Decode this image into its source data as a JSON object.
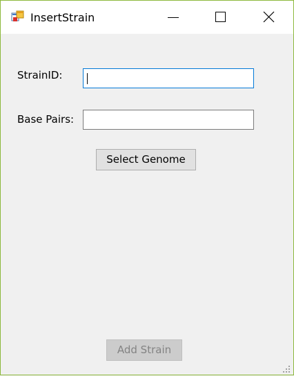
{
  "window": {
    "title": "InsertStrain",
    "icons": {
      "app": "app-window-icon",
      "minimize": "minimize-icon",
      "maximize": "maximize-icon",
      "close": "close-icon"
    }
  },
  "form": {
    "strain_id_label": "StrainID:",
    "strain_id_value": "",
    "base_pairs_label": "Base Pairs:",
    "base_pairs_value": "",
    "select_genome_label": "Select Genome",
    "add_strain_label": "Add Strain",
    "add_strain_enabled": false
  },
  "colors": {
    "window_border": "#8cb83b",
    "focus_border": "#0078d7",
    "background": "#f0f0f0"
  }
}
